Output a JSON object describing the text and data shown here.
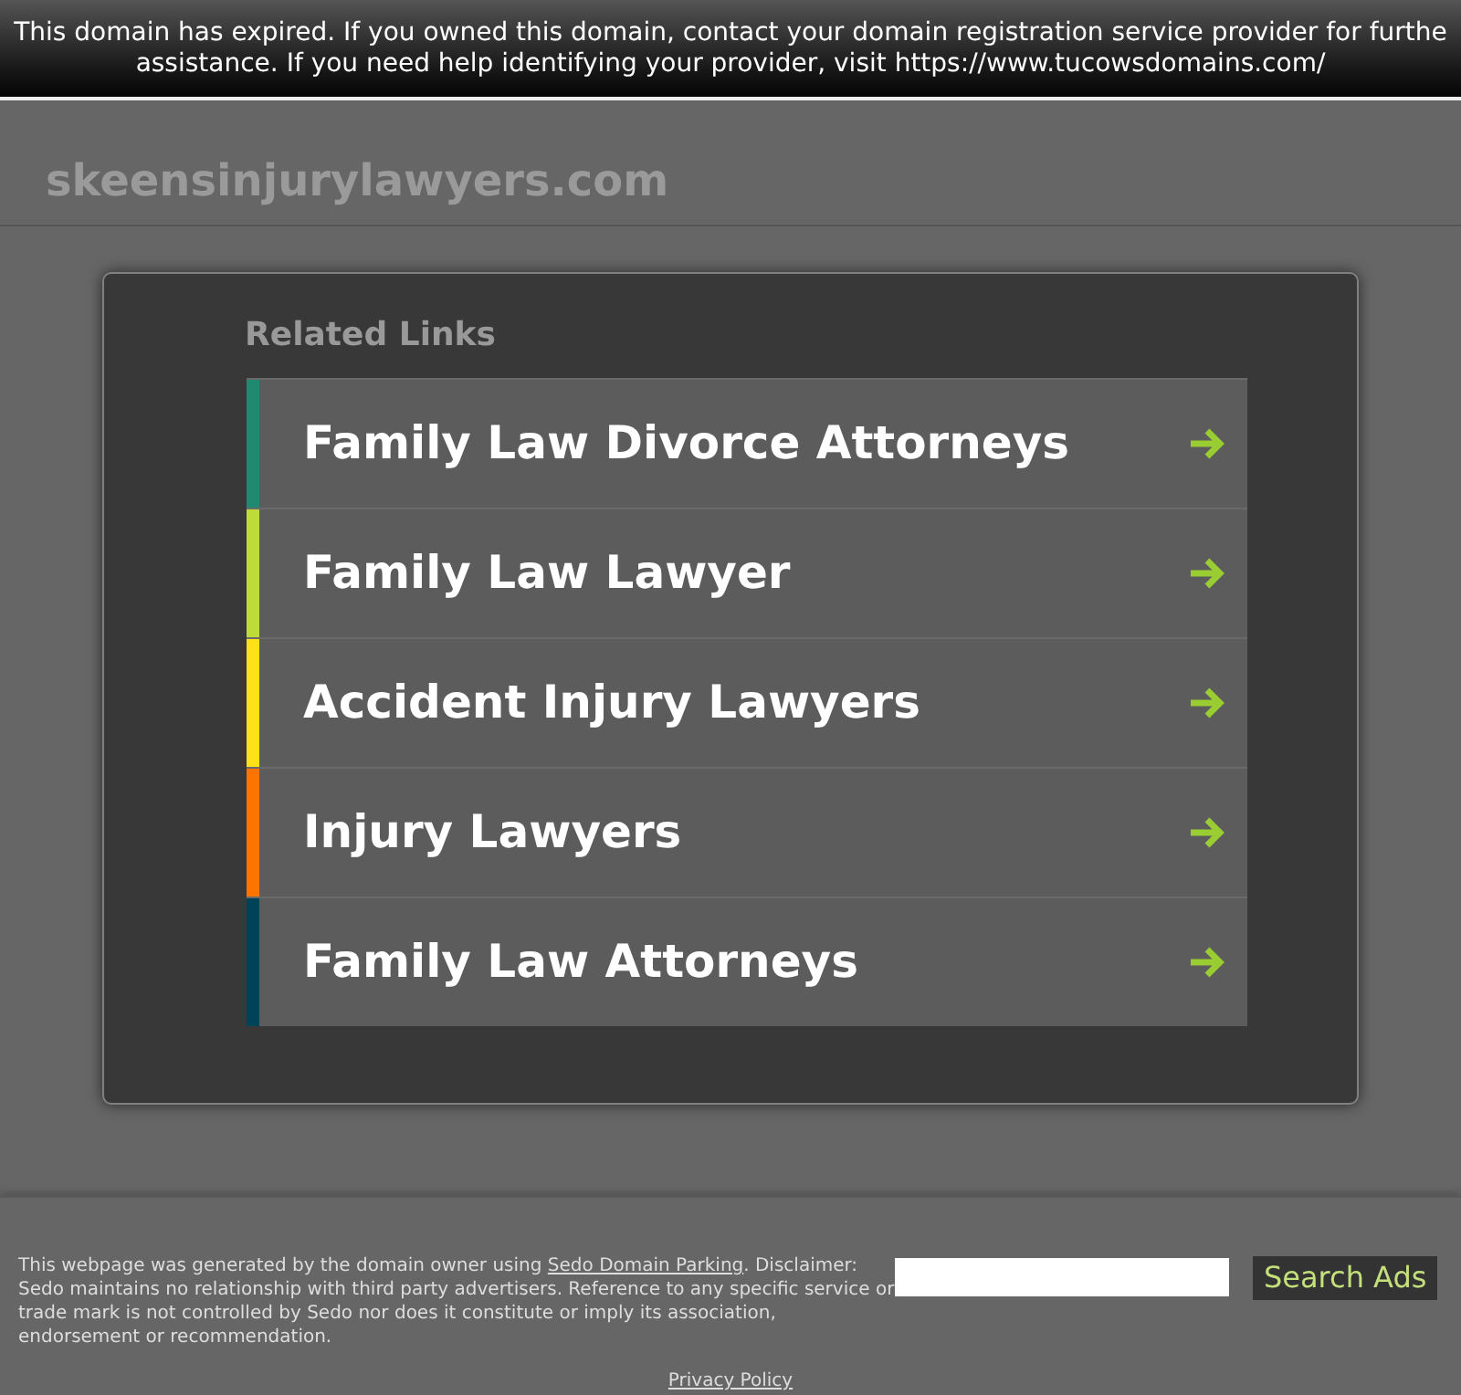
{
  "banner": {
    "lines": [
      "This domain has expired. If you owned this domain, contact your domain registration service provider for furthe",
      "assistance. If you need help identifying your provider, visit https://www.tucowsdomains.com/"
    ]
  },
  "header": {
    "domain": "skeensinjurylawyers.com"
  },
  "related": {
    "title": "Related Links",
    "links": [
      {
        "label": "Family Law Divorce Attorneys",
        "color": "#1f8a70"
      },
      {
        "label": "Family Law Lawyer",
        "color": "#bedb39"
      },
      {
        "label": "Accident Injury Lawyers",
        "color": "#ffe11a"
      },
      {
        "label": "Injury Lawyers",
        "color": "#fd7400"
      },
      {
        "label": "Family Law Attorneys",
        "color": "#004358"
      }
    ]
  },
  "footer": {
    "disclaimer_before": "This webpage was generated by the domain owner using",
    "disclaimer_link": "Sedo Domain Parking",
    "disclaimer_after": ". Disclaimer: Sedo maintains no relationship with third party advertisers. Reference to any specific service or trade mark is not controlled by Sedo nor does it constitute or imply its association, endorsement or recommendation.",
    "search_button": "Search Ads",
    "privacy": "Privacy Policy"
  }
}
